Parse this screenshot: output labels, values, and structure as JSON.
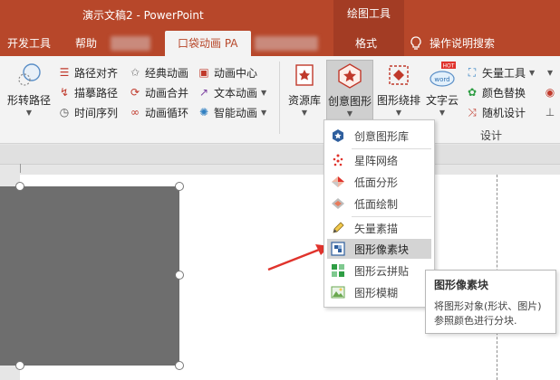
{
  "titlebar": {
    "title": "演示文稿2  -  PowerPoint",
    "contextual_group": "绘图工具"
  },
  "tabs": {
    "developer": "开发工具",
    "help": "帮助",
    "pocket_animation": "口袋动画 PA",
    "format": "格式",
    "tell_me": "操作说明搜索"
  },
  "ribbon": {
    "shape_to_path": "形转路径",
    "path_align": "路径对齐",
    "trace_path": "描摹路径",
    "timeline": "时间序列",
    "classic_anim": "经典动画",
    "anim_merge": "动画合并",
    "anim_loop": "动画循环",
    "anim_center": "动画中心",
    "text_anim": "文本动画",
    "smart_anim": "智能动画",
    "resource_lib": "资源库",
    "creative_shape": "创意图形",
    "shape_wrap": "图形绕排",
    "text_cloud": "文字云",
    "vector_tool": "矢量工具",
    "color_replace": "颜色替换",
    "random_design": "随机设计",
    "design_group": "设计",
    "hot_badge": "HOT",
    "word_badge": "word"
  },
  "menu": {
    "items": [
      "创意图形库",
      "星阵网络",
      "低面分形",
      "低面绘制",
      "矢量素描",
      "图形像素块",
      "图形云拼贴",
      "图形模糊"
    ]
  },
  "tooltip": {
    "title": "图形像素块",
    "description": "将图形对象(形状、图片)参照颜色进行分块."
  },
  "colors": {
    "brand": "#b7472a",
    "context": "#a33c24",
    "shape_fill": "#6e6e6e",
    "arrow": "#e0332c"
  }
}
